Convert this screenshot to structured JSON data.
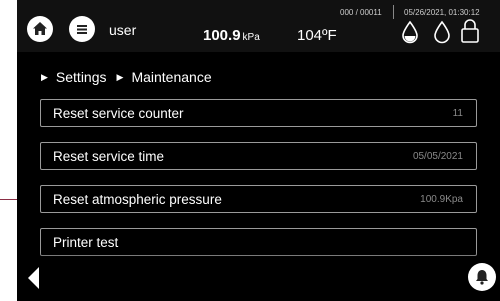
{
  "header": {
    "user": "user",
    "pressure_value": "100.9",
    "pressure_unit": "kPa",
    "temperature": "104ºF",
    "counter": "000 / 00011",
    "datetime": "05/26/2021, 01:30:12"
  },
  "breadcrumb": {
    "items": [
      "Settings",
      "Maintenance"
    ]
  },
  "items": [
    {
      "label": "Reset service counter",
      "value": "11"
    },
    {
      "label": "Reset service time",
      "value": "05/05/2021"
    },
    {
      "label": "Reset atmospheric pressure",
      "value": "100.9Kpa"
    },
    {
      "label": "Printer test",
      "value": ""
    }
  ],
  "icons": {
    "home": "home-icon",
    "menu": "menu-icon",
    "water_drop_filled": "water-drop-filled-icon",
    "water_drop_outline": "water-drop-outline-icon",
    "lock": "lock-icon",
    "back": "back-arrow-icon",
    "bell": "bell-icon"
  },
  "colors": {
    "background": "#000000",
    "border": "#9a9a9a",
    "text": "#ffffff",
    "value_text": "#8a8a8a"
  }
}
